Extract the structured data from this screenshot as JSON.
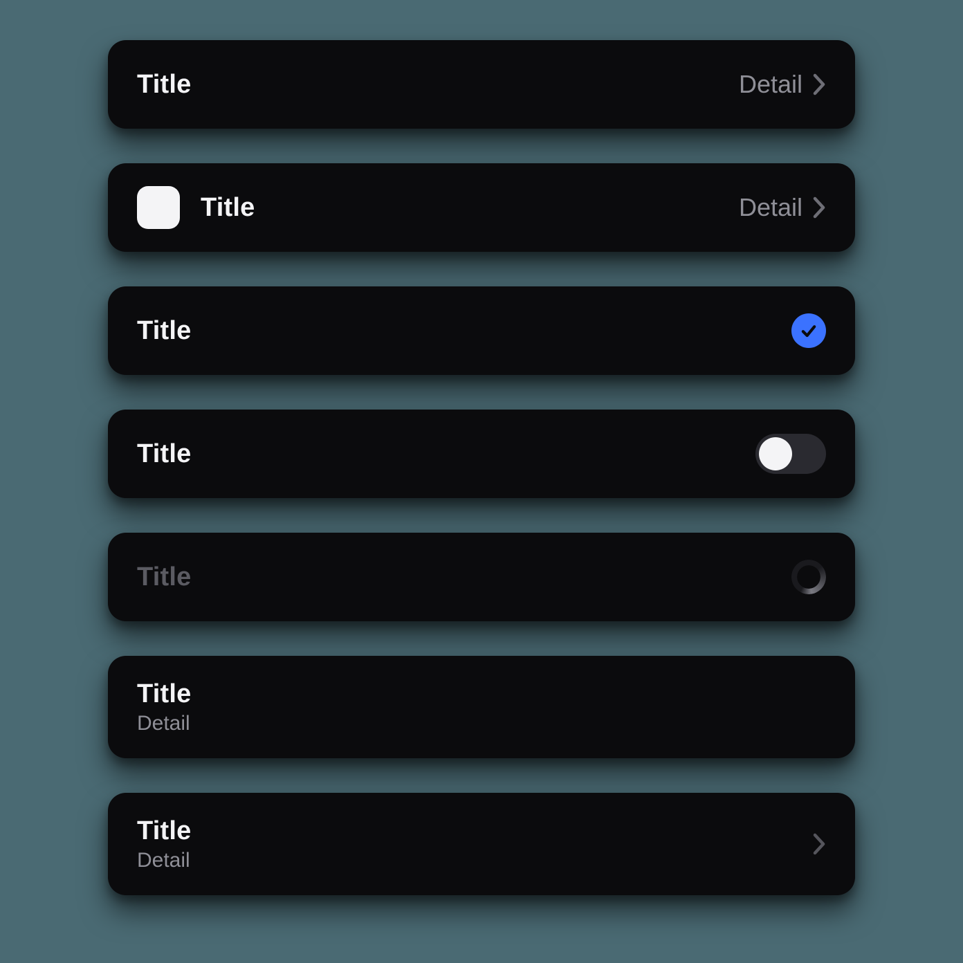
{
  "rows": [
    {
      "title": "Title",
      "detail": "Detail"
    },
    {
      "title": "Title",
      "detail": "Detail"
    },
    {
      "title": "Title"
    },
    {
      "title": "Title"
    },
    {
      "title": "Title"
    },
    {
      "title": "Title",
      "subtitle": "Detail"
    },
    {
      "title": "Title",
      "subtitle": "Detail"
    }
  ],
  "colors": {
    "accent": "#3B72FF",
    "card_bg": "#0b0b0d",
    "page_bg": "#4a6a73",
    "text": "#f4f4f6",
    "muted": "#8f8f97"
  },
  "states": {
    "row3_checked": true,
    "row4_toggle_on": false,
    "row5_loading": true
  }
}
